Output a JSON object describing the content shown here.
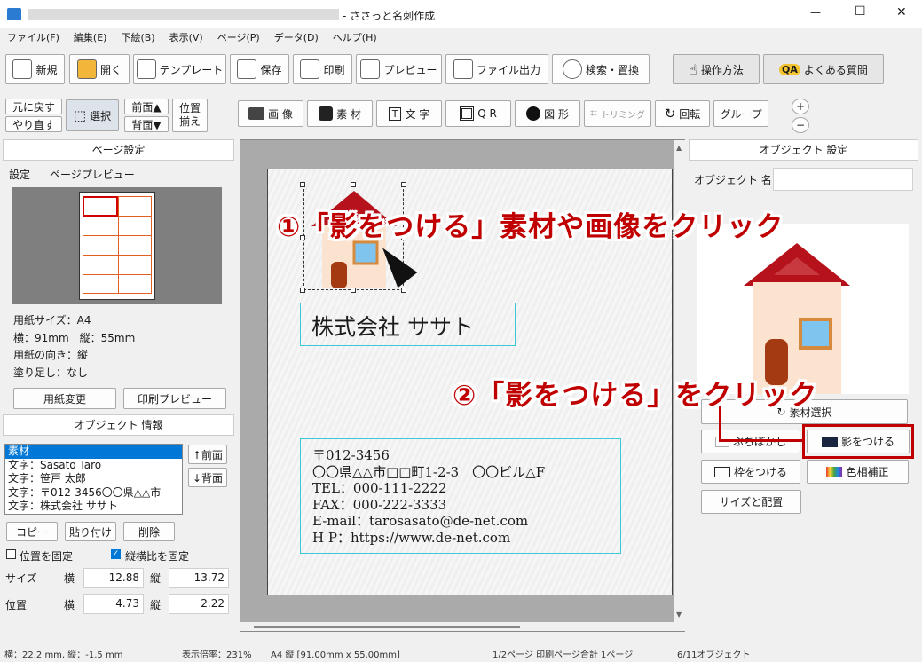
{
  "window": {
    "title": "- ささっと名刺作成",
    "minimize": "—",
    "maximize": "☐",
    "close": "✕"
  },
  "menu": [
    "ファイル(F)",
    "編集(E)",
    "下絵(B)",
    "表示(V)",
    "ページ(P)",
    "データ(D)",
    "ヘルプ(H)"
  ],
  "toolbar1": {
    "new": "新規",
    "open": "開く",
    "template": "テンプレート",
    "save": "保存",
    "print": "印刷",
    "preview": "プレビュー",
    "export": "ファイル出力",
    "search": "検索・置換",
    "howto": "操作方法",
    "faq": "よくある質問"
  },
  "toolbar2": {
    "undo": "元に戻す",
    "redo": "やり直す",
    "select": "選択",
    "front": "前面▲",
    "back": "背面▼",
    "align1": "位置",
    "align2": "揃え",
    "image": "画 像",
    "material": "素 材",
    "text": "文 字",
    "qr": "Q R",
    "shape": "図 形",
    "trim": "トリミング",
    "rotate": "回転",
    "group": "グループ",
    "zoomin": "+",
    "zoomout": "−"
  },
  "page_settings": {
    "title": "ページ設定",
    "tab_settings": "設定",
    "tab_preview": "ページプレビュー",
    "size": "用紙サイズ：A4",
    "dims": "横：91mm　縦：55mm",
    "orient": "用紙の向き：縦",
    "bleed": "塗り足し：なし",
    "change": "用紙変更",
    "print_preview": "印刷プレビュー"
  },
  "object_info": {
    "title": "オブジェクト 情報",
    "items": [
      "素材",
      "文字：Sasato Taro",
      "文字：笹戸 太郎",
      "文字：〒012-3456〇〇県△△市",
      "文字：株式会社 ササト"
    ],
    "front": "↑前面",
    "back": "↓背面",
    "copy": "コピー",
    "paste": "貼り付け",
    "delete": "削除",
    "lock_pos": "位置を固定",
    "lock_ratio": "縦横比を固定",
    "size_label": "サイズ",
    "pos_label": "位置",
    "w": "横",
    "h": "縦",
    "size_w": "12.88",
    "size_h": "13.72",
    "pos_x": "4.73",
    "pos_y": "2.22"
  },
  "card": {
    "company": "株式会社 ササト",
    "lines": [
      "〒012-3456",
      "〇〇県△△市□□町1-2-3　〇〇ビル△F",
      "TEL：000-111-2222",
      "FAX：000-222-3333",
      "E-mail：tarosasato@de-net.com",
      "H P：https://www.de-net.com"
    ]
  },
  "object_settings": {
    "title": "オブジェクト 設定",
    "name_label": "オブジェクト 名",
    "name_value": "",
    "select_material": "素材選択",
    "blur": "ぶちぼかし",
    "shadow": "影をつける",
    "border": "枠をつける",
    "color": "色相補正",
    "size_layout": "サイズと配置"
  },
  "callouts": {
    "step1": "①「影をつける」素材や画像をクリック",
    "step2": "②「影をつける」をクリック"
  },
  "status": {
    "coords": "横：22.2 mm, 縦：-1.5 mm",
    "zoom": "表示倍率：231%",
    "paper": "A4 縦 [91.00mm x 55.00mm]",
    "pages": "1/2ページ 印刷ページ合計 1ページ",
    "objects": "6/11オブジェクト"
  },
  "colors": {
    "accent": "#c00000",
    "selection": "#0078d7",
    "house_roof": "#b5121b"
  }
}
